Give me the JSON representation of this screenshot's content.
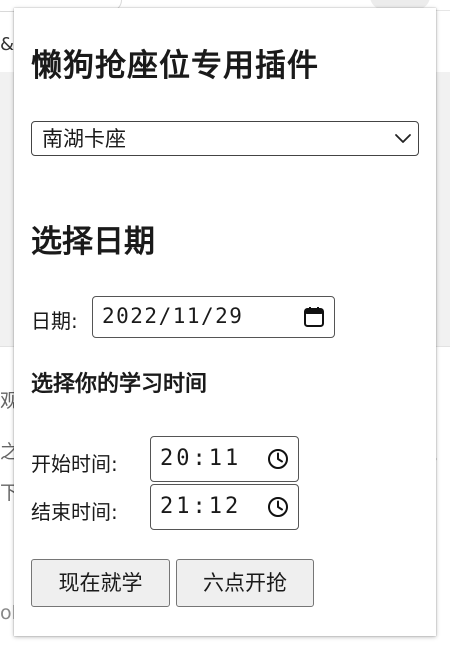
{
  "background": {
    "fragments": [
      "&",
      "观",
      "之",
      "下",
      "ol",
      "，"
    ]
  },
  "popup": {
    "title": "懒狗抢座位专用插件",
    "location_select": {
      "selected": "南湖卡座"
    },
    "date_section": {
      "heading": "选择日期",
      "date_label": "日期:",
      "date_value": "2022/11/29"
    },
    "time_section": {
      "heading": "选择你的学习时间",
      "start_label": "开始时间:",
      "start_value": "20:11",
      "end_label": "结束时间:",
      "end_value": "21:12"
    },
    "buttons": {
      "study_now": "现在就学",
      "grab_at_six": "六点开抢"
    }
  }
}
